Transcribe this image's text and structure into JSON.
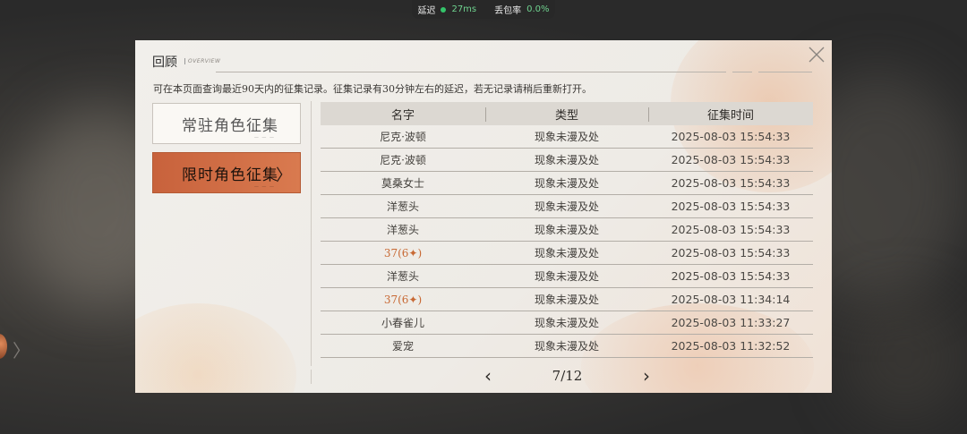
{
  "network": {
    "latency_label": "延迟",
    "latency_value": "27ms",
    "loss_label": "丢包率",
    "loss_value": "0.0%",
    "status_color": "#34c46a"
  },
  "panel": {
    "title": "回顾",
    "title_en": "OVERVIEW",
    "note": "可在本页面查询最近90天内的征集记录。征集记录有30分钟左右的延迟，若无记录请稍后重新打开。",
    "close_icon": "close-icon"
  },
  "tabs": [
    {
      "label": "常驻角色征集",
      "active": false
    },
    {
      "label": "限时角色征集",
      "active": true
    }
  ],
  "table": {
    "headers": [
      "名字",
      "类型",
      "征集时间"
    ],
    "rows": [
      {
        "name": "尼克·波顿",
        "type": "现象未漫及处",
        "time": "2025-08-03 15:54:33",
        "highlight": false
      },
      {
        "name": "尼克·波顿",
        "type": "现象未漫及处",
        "time": "2025-08-03 15:54:33",
        "highlight": false
      },
      {
        "name": "莫桑女士",
        "type": "现象未漫及处",
        "time": "2025-08-03 15:54:33",
        "highlight": false
      },
      {
        "name": "洋葱头",
        "type": "现象未漫及处",
        "time": "2025-08-03 15:54:33",
        "highlight": false
      },
      {
        "name": "洋葱头",
        "type": "现象未漫及处",
        "time": "2025-08-03 15:54:33",
        "highlight": false
      },
      {
        "name": "37(6✦)",
        "type": "现象未漫及处",
        "time": "2025-08-03 15:54:33",
        "highlight": true
      },
      {
        "name": "洋葱头",
        "type": "现象未漫及处",
        "time": "2025-08-03 15:54:33",
        "highlight": false
      },
      {
        "name": "37(6✦)",
        "type": "现象未漫及处",
        "time": "2025-08-03 11:34:14",
        "highlight": true
      },
      {
        "name": "小春雀儿",
        "type": "现象未漫及处",
        "time": "2025-08-03 11:33:27",
        "highlight": false
      },
      {
        "name": "爱宠",
        "type": "现象未漫及处",
        "time": "2025-08-03 11:32:52",
        "highlight": false
      }
    ]
  },
  "pager": {
    "text": "7/12",
    "prev": "‹",
    "next": "›"
  },
  "colors": {
    "accent": "#d0693f",
    "highlight_text": "#c86a35"
  }
}
